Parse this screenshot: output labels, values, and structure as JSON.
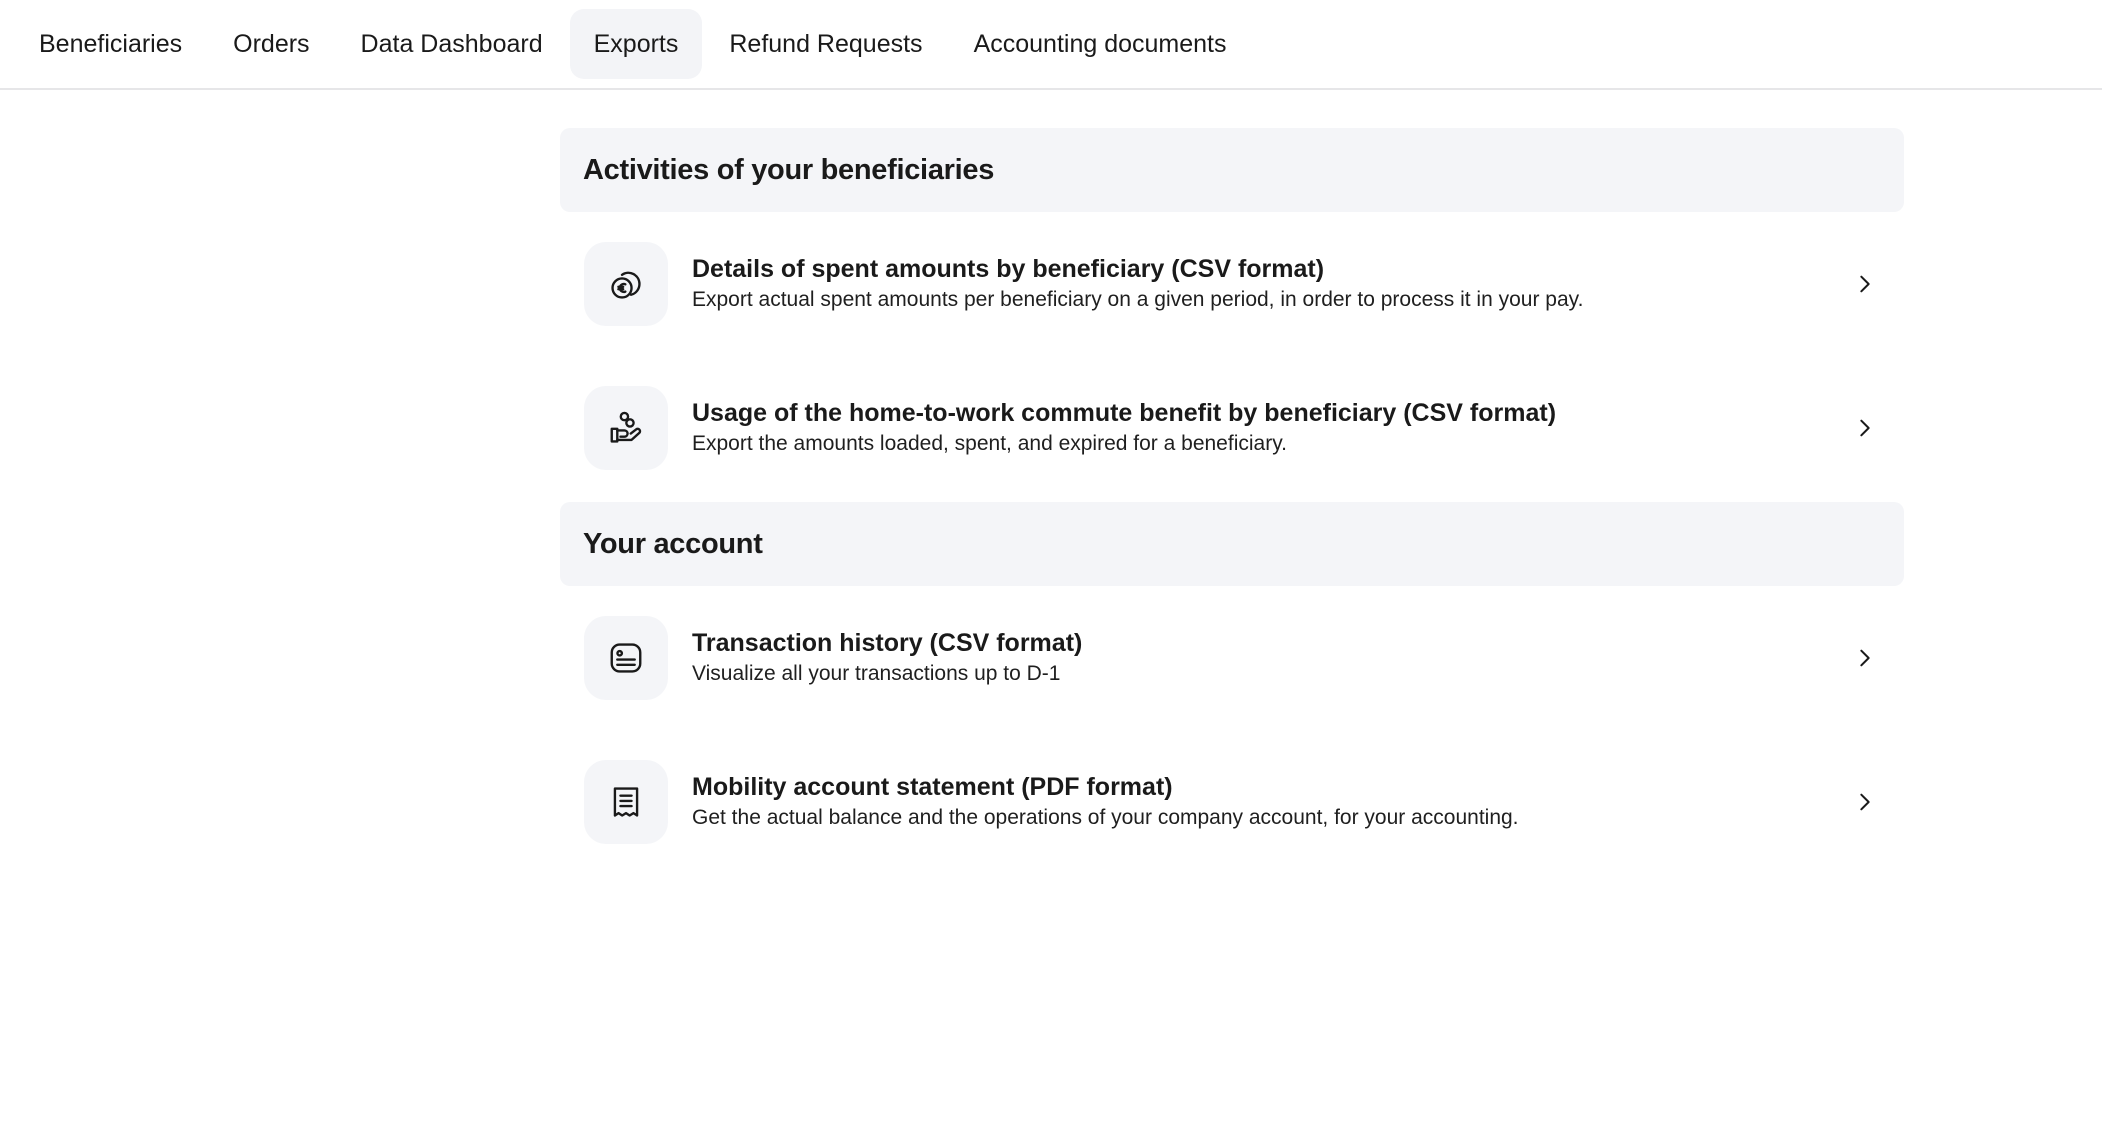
{
  "nav": {
    "tabs": [
      {
        "label": "Beneficiaries"
      },
      {
        "label": "Orders"
      },
      {
        "label": "Data Dashboard"
      },
      {
        "label": "Exports",
        "active": true
      },
      {
        "label": "Refund Requests"
      },
      {
        "label": "Accounting documents"
      }
    ]
  },
  "sections": [
    {
      "title": "Activities of your beneficiaries",
      "items": [
        {
          "icon": "euro-coins-icon",
          "title": "Details of spent amounts by beneficiary (CSV format)",
          "description": "Export actual spent amounts per beneficiary on a given period, in order to process it in your pay."
        },
        {
          "icon": "hand-coins-icon",
          "title": "Usage of the home-to-work commute benefit by beneficiary (CSV format)",
          "description": "Export the amounts loaded, spent, and expired for a beneficiary."
        }
      ]
    },
    {
      "title": "Your account",
      "items": [
        {
          "icon": "card-list-icon",
          "title": "Transaction history (CSV format)",
          "description": "Visualize all your transactions up to D-1"
        },
        {
          "icon": "receipt-icon",
          "title": "Mobility account statement (PDF format)",
          "description": "Get the actual balance and the operations of your company account, for your accounting."
        }
      ]
    }
  ],
  "colors": {
    "active_tab_bg": "#f3f4f7",
    "section_bg": "#f4f5f8",
    "divider": "#e6e6e8"
  }
}
